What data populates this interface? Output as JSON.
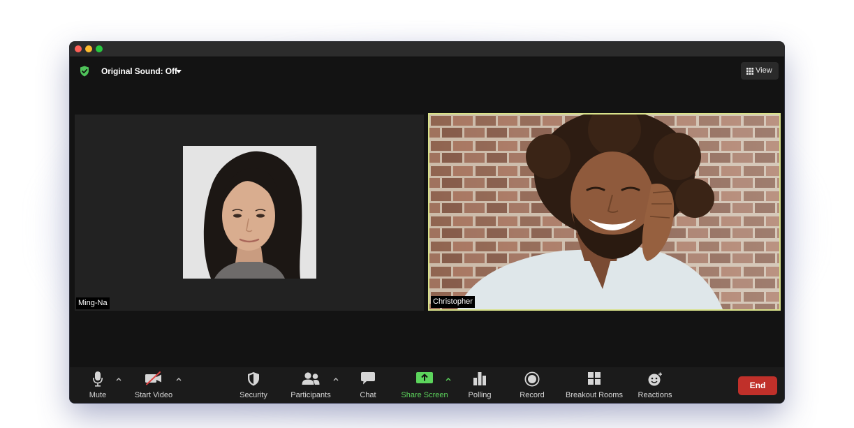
{
  "window": {
    "traffic_lights": [
      "close",
      "minimize",
      "zoom"
    ]
  },
  "topbar": {
    "security_icon": "shield-check-icon",
    "sound_label": "Original Sound: Off",
    "view_label": "View"
  },
  "participants": [
    {
      "name": "Ming-Na",
      "video_on": false,
      "active_speaker": false
    },
    {
      "name": "Christopher",
      "video_on": true,
      "active_speaker": true
    }
  ],
  "toolbar": {
    "mute": "Mute",
    "start_video": "Start Video",
    "security": "Security",
    "participants": "Participants",
    "chat": "Chat",
    "share_screen": "Share Screen",
    "polling": "Polling",
    "record": "Record",
    "breakout_rooms": "Breakout Rooms",
    "reactions": "Reactions",
    "end": "End"
  },
  "colors": {
    "accent_green": "#5cd55c",
    "end_red": "#c0302a",
    "speaker_border": "#d9e28a",
    "shield_green": "#4fc35a"
  }
}
